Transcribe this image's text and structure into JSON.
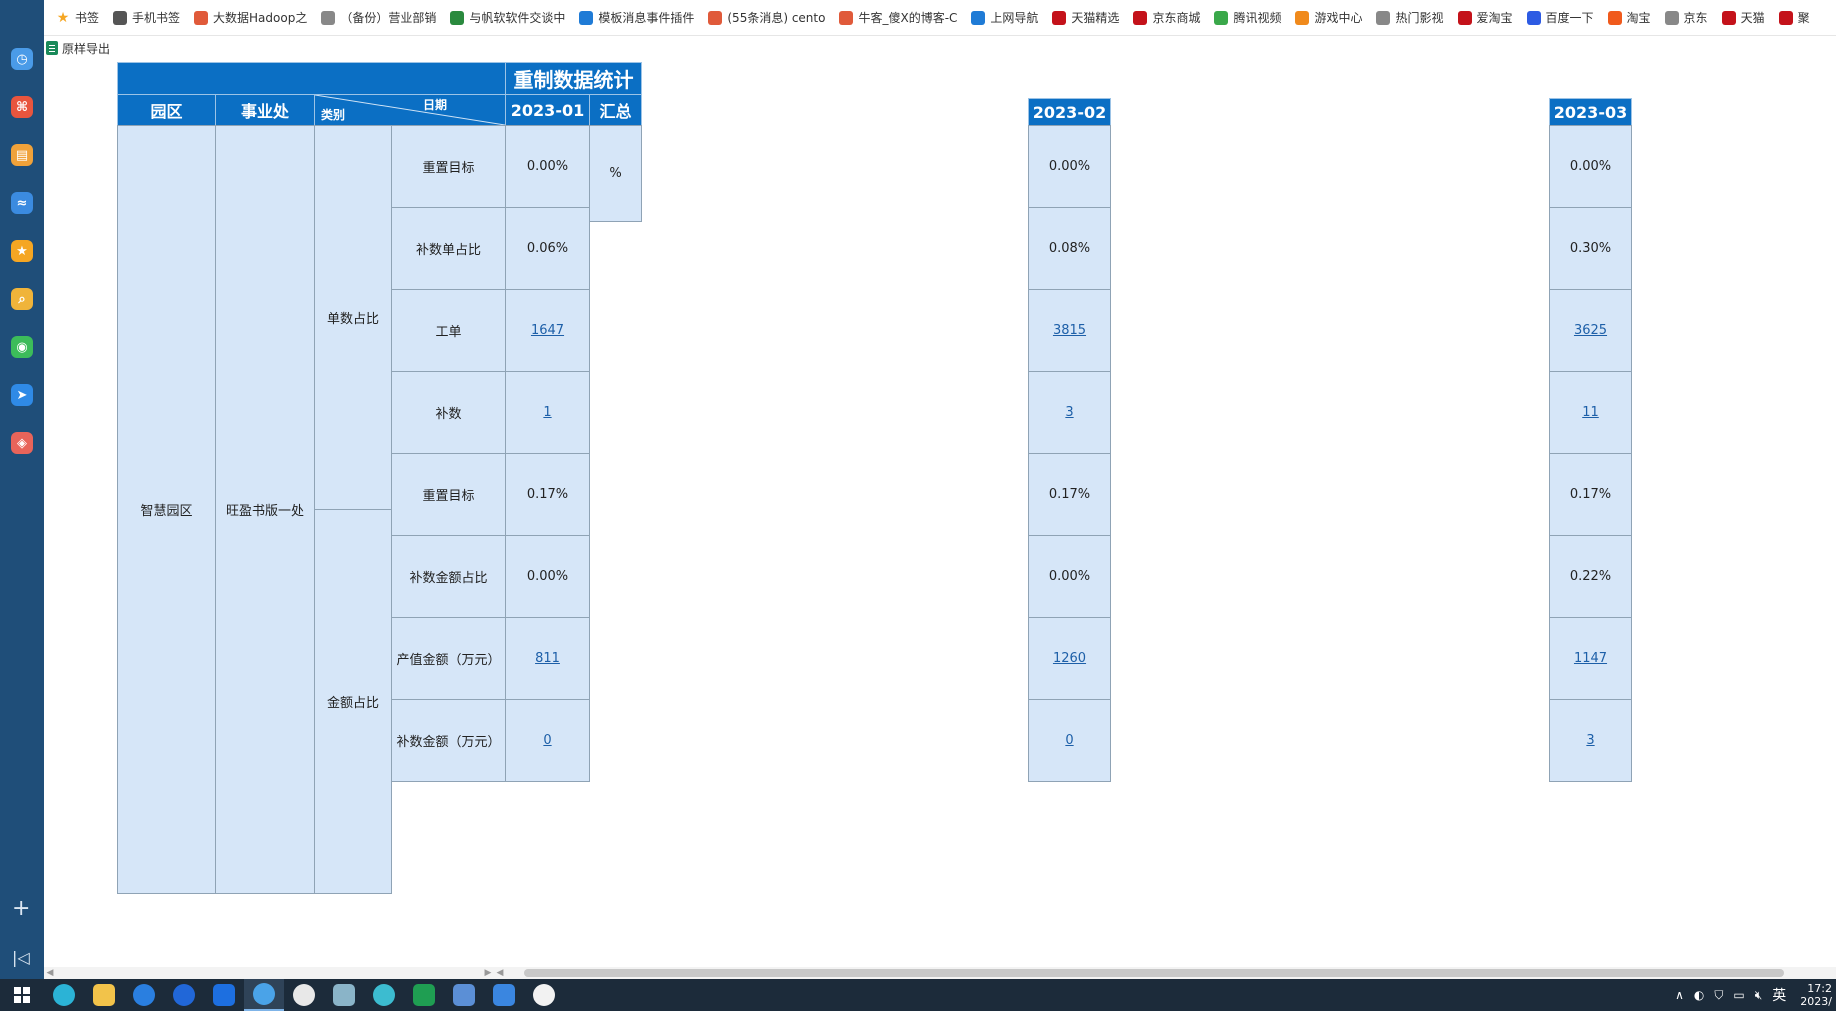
{
  "bookmarks": [
    {
      "label": "书签",
      "icon": "star-icon",
      "color": "#f5a623"
    },
    {
      "label": "手机书签",
      "icon": "phone-icon",
      "color": "#555555"
    },
    {
      "label": "大数据Hadoop之",
      "icon": "c-site-icon",
      "color": "#e05a3a"
    },
    {
      "label": "（备份）营业部销",
      "icon": "globe-icon",
      "color": "#888888"
    },
    {
      "label": "与帆软软件交谈中",
      "icon": "fanruan-icon",
      "color": "#2a8a3e"
    },
    {
      "label": "模板消息事件插件",
      "icon": "doc-icon",
      "color": "#1f7bd6"
    },
    {
      "label": "(55条消息) cento",
      "icon": "c-site-icon",
      "color": "#e05a3a"
    },
    {
      "label": "牛客_傻X的博客-C",
      "icon": "c-site-icon",
      "color": "#e05a3a"
    },
    {
      "label": "上网导航",
      "icon": "e-icon",
      "color": "#1f7bd6"
    },
    {
      "label": "天猫精选",
      "icon": "tmall-icon",
      "color": "#c4121a"
    },
    {
      "label": "京东商城",
      "icon": "jd-icon",
      "color": "#c4121a"
    },
    {
      "label": "腾讯视频",
      "icon": "play-icon",
      "color": "#3aa84a"
    },
    {
      "label": "游戏中心",
      "icon": "game-icon",
      "color": "#f08a1c"
    },
    {
      "label": "热门影视",
      "icon": "globe-icon",
      "color": "#888888"
    },
    {
      "label": "爱淘宝",
      "icon": "taobao-icon",
      "color": "#c4121a"
    },
    {
      "label": "百度一下",
      "icon": "baidu-icon",
      "color": "#2d5be3"
    },
    {
      "label": "淘宝",
      "icon": "taobao-icon",
      "color": "#f05a1c"
    },
    {
      "label": "京东",
      "icon": "globe-icon",
      "color": "#888888"
    },
    {
      "label": "天猫",
      "icon": "tmall-icon",
      "color": "#c4121a"
    },
    {
      "label": "聚",
      "icon": "tmall-icon",
      "color": "#c4121a"
    }
  ],
  "toolbar": {
    "export_label": "原样导出"
  },
  "report": {
    "title": "重制数据统计",
    "col_park": "园区",
    "col_division": "事业处",
    "col_category": "类别",
    "col_date": "日期",
    "col_total": "汇总",
    "periods": [
      "2023-01",
      "2023-02",
      "2023-03"
    ],
    "park": "智慧园区",
    "division": "旺盈书版一处",
    "groups": [
      {
        "name": "单数占比",
        "metrics": [
          "重置目标",
          "补数单占比",
          "工单",
          "补数"
        ]
      },
      {
        "name": "金额占比",
        "metrics": [
          "重置目标",
          "补数金额占比",
          "产值金额（万元）",
          "补数金额（万元）"
        ]
      }
    ],
    "values": [
      [
        "0.00%",
        "0.06%",
        "1647",
        "1",
        "0.17%",
        "0.00%",
        "811",
        "0"
      ],
      [
        "0.00%",
        "0.08%",
        "3815",
        "3",
        "0.17%",
        "0.00%",
        "1260",
        "0"
      ],
      [
        "0.00%",
        "0.30%",
        "3625",
        "11",
        "0.17%",
        "0.22%",
        "1147",
        "3"
      ]
    ],
    "link_rows": [
      2,
      3,
      6,
      7
    ],
    "total_value": "%"
  },
  "tray": {
    "ime": "英",
    "time": "17:2",
    "date": "2023/"
  },
  "colors": {
    "header_bg": "#0b6fc4",
    "cell_bg": "#d6e6f8",
    "rail_bg": "#1f4e79",
    "taskbar_bg": "#1c2b3a"
  }
}
